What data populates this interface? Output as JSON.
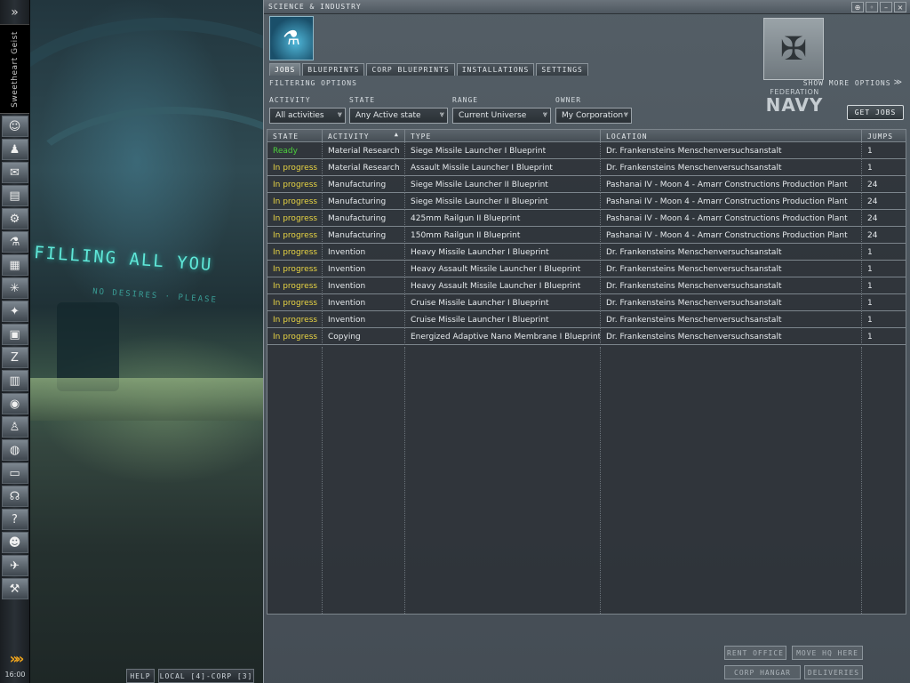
{
  "sidebar": {
    "collapse_glyph": "»",
    "character_name": "Sweetheart Geist",
    "buttons": [
      {
        "icon": "character-sheet-icon",
        "glyph": "☺"
      },
      {
        "icon": "people-icon",
        "glyph": "♟"
      },
      {
        "icon": "mail-icon",
        "glyph": "✉"
      },
      {
        "icon": "notepad-icon",
        "glyph": "▤"
      },
      {
        "icon": "fitting-icon",
        "glyph": "⚙"
      },
      {
        "icon": "science-industry-icon",
        "glyph": "⚗"
      },
      {
        "icon": "map-icon",
        "glyph": "▦"
      },
      {
        "icon": "starmap-icon",
        "glyph": "✳"
      },
      {
        "icon": "agents-icon",
        "glyph": "✦"
      },
      {
        "icon": "assets-icon",
        "glyph": "▣"
      },
      {
        "icon": "corporation-icon",
        "glyph": "Z"
      },
      {
        "icon": "calculator-icon",
        "glyph": "▥"
      },
      {
        "icon": "help-icon",
        "glyph": "◉"
      },
      {
        "icon": "contracts-icon",
        "glyph": "♙"
      },
      {
        "icon": "browser-icon",
        "glyph": "◍"
      },
      {
        "icon": "journal-icon",
        "glyph": "▭"
      },
      {
        "icon": "audio-icon",
        "glyph": "☊"
      },
      {
        "icon": "info-icon",
        "glyph": "?"
      },
      {
        "icon": "portrait-icon",
        "glyph": "☻"
      },
      {
        "icon": "drones-icon",
        "glyph": "✈"
      },
      {
        "icon": "market-icon",
        "glyph": "⚒"
      }
    ],
    "chevron_glyph": "»»",
    "clock": "16:00"
  },
  "scene": {
    "sign_main": "FILLING ALL YOU",
    "sign_sub": "NO DESIRES · PLEASE"
  },
  "chat": {
    "help_label": "HELP",
    "local_label": "LOCAL [4]-CORP [3]"
  },
  "window": {
    "title": "SCIENCE & INDUSTRY",
    "buttons": [
      "⊕",
      "◦",
      "–",
      "×"
    ],
    "tabs": [
      "JOBS",
      "BLUEPRINTS",
      "CORP BLUEPRINTS",
      "INSTALLATIONS",
      "SETTINGS"
    ],
    "active_tab": "JOBS",
    "corp_logo_glyph": "✠",
    "corp_name_small": "FEDERATION",
    "corp_name_big": "NAVY"
  },
  "filters": {
    "section_label": "FILTERING OPTIONS",
    "show_more_label": "SHOW MORE OPTIONS",
    "activity": {
      "label": "ACTIVITY",
      "value": "All activities"
    },
    "state": {
      "label": "STATE",
      "value": "Any Active state"
    },
    "range": {
      "label": "RANGE",
      "value": "Current Universe"
    },
    "owner": {
      "label": "OWNER",
      "value": "My Corporation"
    },
    "get_jobs_label": "GET JOBS"
  },
  "jobs_table": {
    "headers": [
      "STATE",
      "ACTIVITY",
      "TYPE",
      "LOCATION",
      "JUMPS"
    ],
    "sorted_column": "ACTIVITY",
    "rows": [
      {
        "state": "Ready",
        "activity": "Material Research",
        "type": "Siege Missile Launcher I Blueprint",
        "location": "Dr. Frankensteins Menschenversuchsanstalt",
        "jumps": "1"
      },
      {
        "state": "In progress",
        "activity": "Material Research",
        "type": "Assault Missile Launcher I Blueprint",
        "location": "Dr. Frankensteins Menschenversuchsanstalt",
        "jumps": "1"
      },
      {
        "state": "In progress",
        "activity": "Manufacturing",
        "type": "Siege Missile Launcher II Blueprint",
        "location": "Pashanai IV - Moon 4 - Amarr Constructions Production Plant",
        "jumps": "24"
      },
      {
        "state": "In progress",
        "activity": "Manufacturing",
        "type": "Siege Missile Launcher II Blueprint",
        "location": "Pashanai IV - Moon 4 - Amarr Constructions Production Plant",
        "jumps": "24"
      },
      {
        "state": "In progress",
        "activity": "Manufacturing",
        "type": "425mm Railgun II Blueprint",
        "location": "Pashanai IV - Moon 4 - Amarr Constructions Production Plant",
        "jumps": "24"
      },
      {
        "state": "In progress",
        "activity": "Manufacturing",
        "type": "150mm Railgun II Blueprint",
        "location": "Pashanai IV - Moon 4 - Amarr Constructions Production Plant",
        "jumps": "24"
      },
      {
        "state": "In progress",
        "activity": "Invention",
        "type": "Heavy Missile Launcher I Blueprint",
        "location": "Dr. Frankensteins Menschenversuchsanstalt",
        "jumps": "1"
      },
      {
        "state": "In progress",
        "activity": "Invention",
        "type": "Heavy Assault Missile Launcher I Blueprint",
        "location": "Dr. Frankensteins Menschenversuchsanstalt",
        "jumps": "1"
      },
      {
        "state": "In progress",
        "activity": "Invention",
        "type": "Heavy Assault Missile Launcher I Blueprint",
        "location": "Dr. Frankensteins Menschenversuchsanstalt",
        "jumps": "1"
      },
      {
        "state": "In progress",
        "activity": "Invention",
        "type": "Cruise Missile Launcher I Blueprint",
        "location": "Dr. Frankensteins Menschenversuchsanstalt",
        "jumps": "1"
      },
      {
        "state": "In progress",
        "activity": "Invention",
        "type": "Cruise Missile Launcher I Blueprint",
        "location": "Dr. Frankensteins Menschenversuchsanstalt",
        "jumps": "1"
      },
      {
        "state": "In progress",
        "activity": "Copying",
        "type": "Energized Adaptive Nano Membrane I Blueprint",
        "location": "Dr. Frankensteins Menschenversuchsanstalt",
        "jumps": "1"
      }
    ]
  },
  "station_buttons": {
    "rent_office": "RENT OFFICE",
    "move_hq": "MOVE HQ HERE",
    "corp_hangar": "CORP HANGAR",
    "deliveries": "DELIVERIES"
  },
  "colors": {
    "ready": "#4bd13b",
    "in_progress": "#e8d443",
    "accent_orange": "#f0a51c"
  }
}
